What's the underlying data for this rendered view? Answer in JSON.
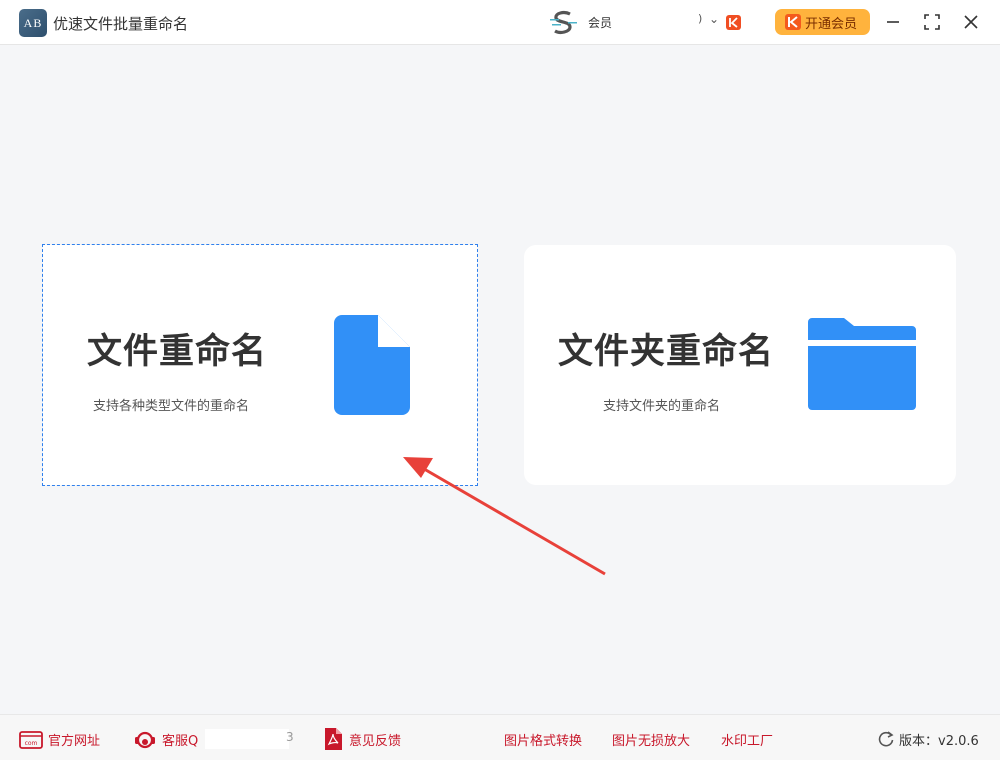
{
  "app": {
    "title": "优速文件批量重命名",
    "logo_text": "AB"
  },
  "account": {
    "label": "会员",
    "caret": ")",
    "chevron": "⌄"
  },
  "header": {
    "vip_button": "开通会员"
  },
  "cards": [
    {
      "title": "文件重命名",
      "subtitle": "支持各种类型文件的重命名",
      "icon": "file-icon"
    },
    {
      "title": "文件夹重命名",
      "subtitle": "支持文件夹的重命名",
      "icon": "folder-icon"
    }
  ],
  "footer": {
    "site": "官方网址",
    "service": "客服Q",
    "service_tail": "3",
    "feedback": "意见反馈",
    "links": [
      "图片格式转换",
      "图片无损放大",
      "水印工厂"
    ],
    "version": "版本：v2.0.6"
  },
  "colors": {
    "accent_blue": "#3190f7",
    "vip_orange": "#ffb33d",
    "footer_red": "#c8182b",
    "arrow_red": "#e8413a"
  }
}
